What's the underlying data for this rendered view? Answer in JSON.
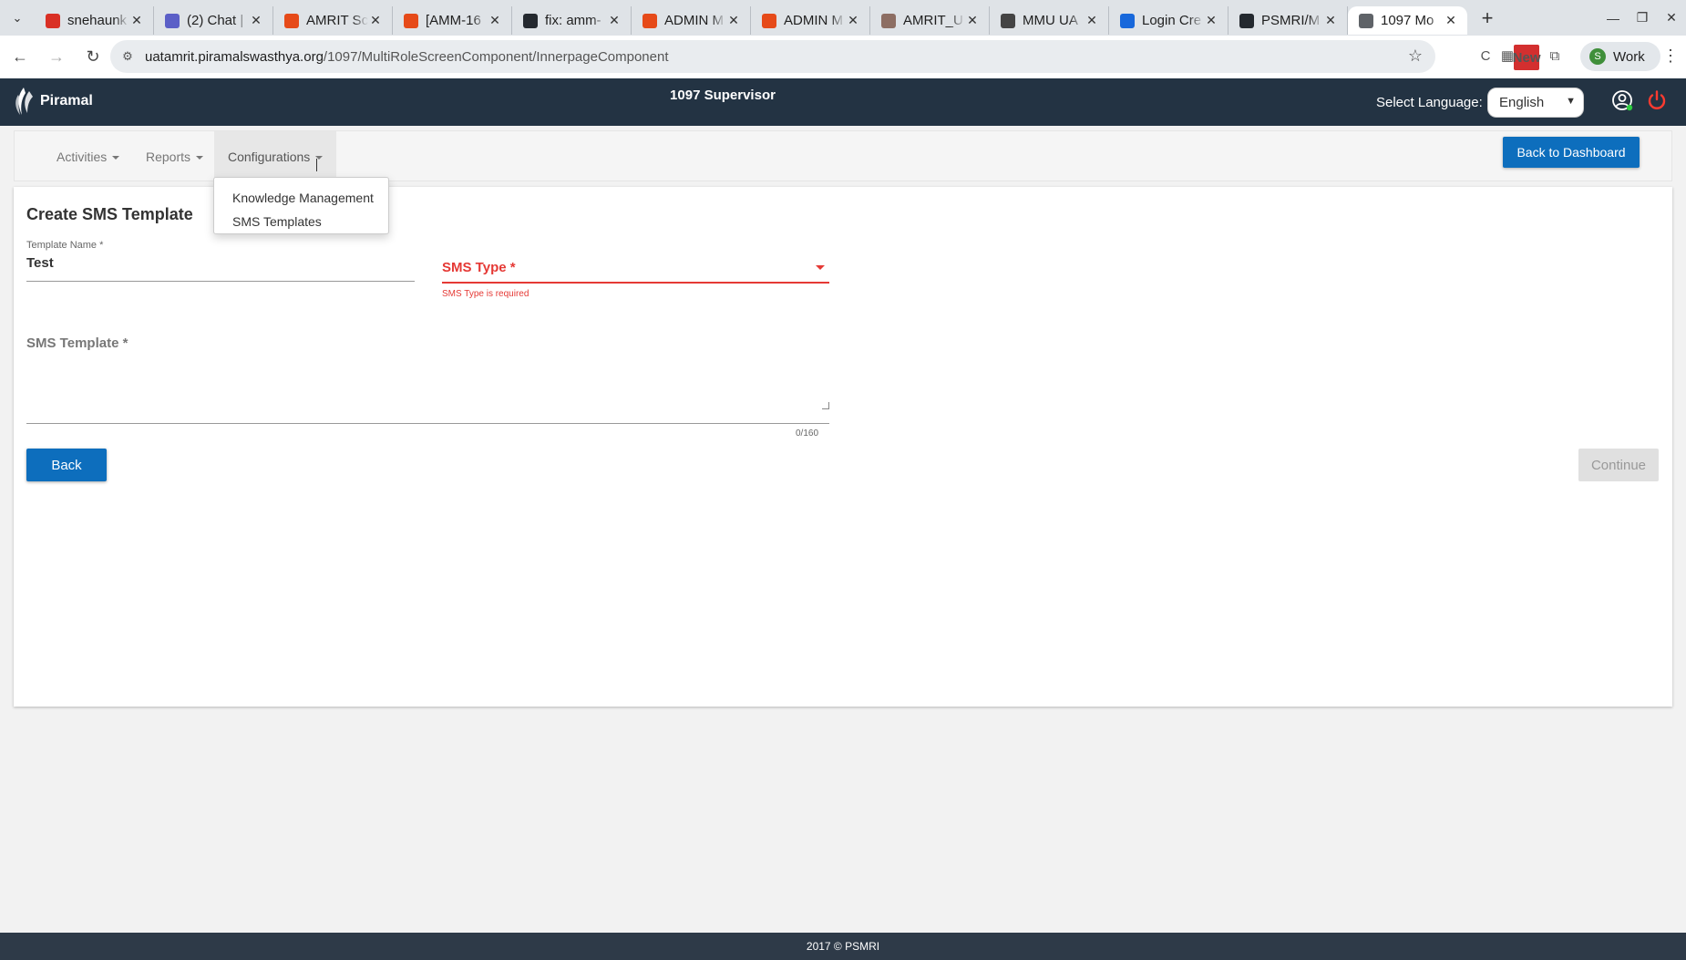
{
  "browser": {
    "tabs": [
      {
        "title": "snehaunk",
        "icon": "gmail-icon",
        "color": "#d93025"
      },
      {
        "title": "(2) Chat |",
        "icon": "teams-icon",
        "color": "#5b5fc7"
      },
      {
        "title": "AMRIT Sc",
        "icon": "amrit-icon",
        "color": "#e64a19"
      },
      {
        "title": "[AMM-16",
        "icon": "amrit-icon",
        "color": "#e64a19"
      },
      {
        "title": "fix: amm-",
        "icon": "github-icon",
        "color": "#24292f"
      },
      {
        "title": "ADMIN M",
        "icon": "amrit-icon",
        "color": "#e64a19"
      },
      {
        "title": "ADMIN M",
        "icon": "amrit-icon",
        "color": "#e64a19"
      },
      {
        "title": "AMRIT_U",
        "icon": "person-icon",
        "color": "#8d6e63"
      },
      {
        "title": "MMU UA",
        "icon": "openai-icon",
        "color": "#444444"
      },
      {
        "title": "Login Cre",
        "icon": "confluence-icon",
        "color": "#1868db"
      },
      {
        "title": "PSMRI/M",
        "icon": "github-icon",
        "color": "#24292f"
      },
      {
        "title": "1097 Mo",
        "icon": "globe-icon",
        "color": "#5f6368",
        "active": true
      }
    ],
    "url_host": "uatamrit.piramalswasthya.org",
    "url_path": "/1097/MultiRoleScreenComponent/InnerpageComponent",
    "profile_label": "Work",
    "profile_initial": "S",
    "new_badge": "New"
  },
  "app": {
    "logo_text": "Piramal",
    "title": "1097 Supervisor",
    "language_label": "Select Language:",
    "language_value": "English",
    "brand_color": "#233343",
    "accent_color": "#0d6ebd",
    "error_color": "#e53935"
  },
  "menu": {
    "items": [
      {
        "label": "Activities"
      },
      {
        "label": "Reports"
      },
      {
        "label": "Configurations"
      }
    ],
    "dashboard_button": "Back to Dashboard",
    "dropdown": [
      "Knowledge Management",
      "SMS Templates"
    ]
  },
  "form": {
    "title": "Create SMS Template",
    "template_name_label": "Template Name *",
    "template_name_value": "Test",
    "sms_type_label": "SMS Type *",
    "sms_type_error": "SMS Type is required",
    "sms_template_label": "SMS Template *",
    "char_count": "0/160",
    "back_button": "Back",
    "continue_button": "Continue"
  },
  "footer": {
    "text": "2017 © PSMRI"
  }
}
